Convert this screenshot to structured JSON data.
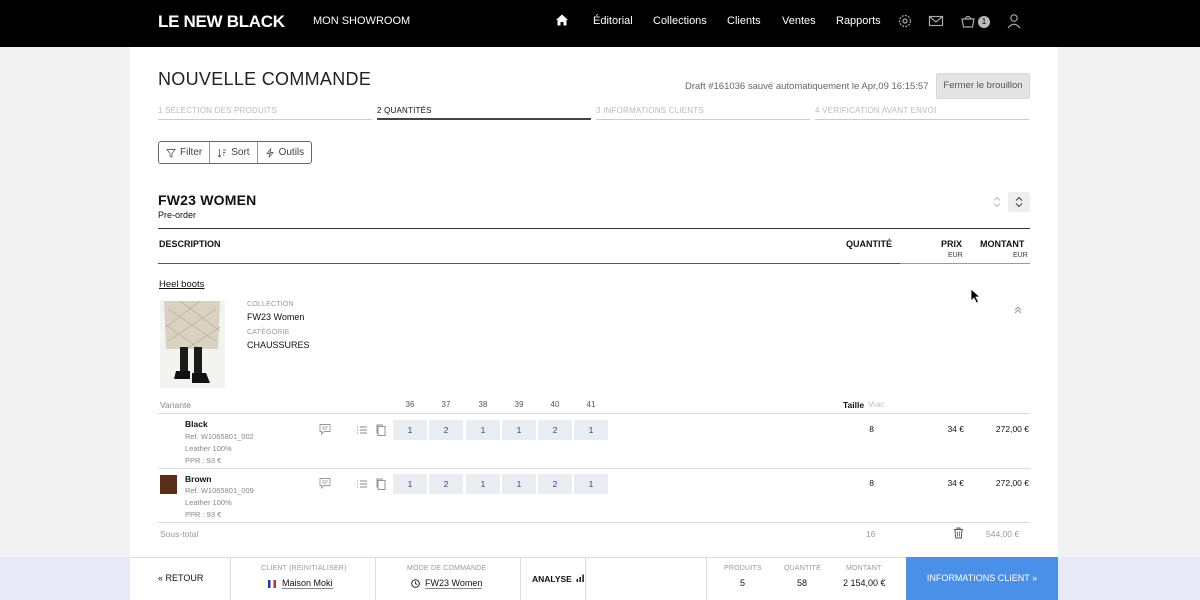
{
  "header": {
    "logo": "LE NEW BLACK",
    "showroom": "MON SHOWROOM",
    "nav": [
      "Éditorial",
      "Collections",
      "Clients",
      "Ventes",
      "Rapports"
    ],
    "cart_count": "1"
  },
  "page": {
    "title": "NOUVELLE COMMANDE",
    "draft_status": "Draft #161036 sauvé automatiquement le Apr,09 16:15:57",
    "close_draft": "Fermer le brouillon"
  },
  "steps": [
    {
      "label": "1 SÉLECTION DES PRODUITS",
      "active": false
    },
    {
      "label": "2 QUANTITÉS",
      "active": true
    },
    {
      "label": "3 INFORMATIONS CLIENTS",
      "active": false
    },
    {
      "label": "4 VÉRIFICATION AVANT ENVOI",
      "active": false
    }
  ],
  "toolbar": {
    "filter": "Filter",
    "sort": "Sort",
    "tools": "Outils"
  },
  "section": {
    "title": "FW23 WOMEN",
    "subtitle": "Pre-order"
  },
  "table_headers": {
    "description": "DESCRIPTION",
    "quantity": "QUANTITÉ",
    "price": "PRIX",
    "price_unit": "EUR",
    "amount": "MONTANT",
    "amount_unit": "EUR"
  },
  "product": {
    "name": "Heel boots",
    "collection_label": "COLLECTION",
    "collection": "FW23 Women",
    "category_label": "CATÉGORIE",
    "category": "CHAUSSURES"
  },
  "grid": {
    "variant_label": "Variante",
    "sizes": [
      "36",
      "37",
      "38",
      "39",
      "40",
      "41"
    ],
    "taille": "Taille",
    "vrac": "Vrac"
  },
  "variants": [
    {
      "name": "Black",
      "ref": "Ref. W1065801_002",
      "material": "Leather 100%",
      "ppr": "PPR : 93 €",
      "swatch": "#ffffff",
      "quantities": [
        "1",
        "2",
        "1",
        "1",
        "2",
        "1"
      ],
      "total_qty": "8",
      "price": "34 €",
      "amount": "272,00 €"
    },
    {
      "name": "Brown",
      "ref": "Ref. W1065801_009",
      "material": "Leather 100%",
      "ppr": "PPR : 93 €",
      "swatch": "#5a2e1a",
      "quantities": [
        "1",
        "2",
        "1",
        "1",
        "2",
        "1"
      ],
      "total_qty": "8",
      "price": "34 €",
      "amount": "272,00 €"
    }
  ],
  "subtotal": {
    "label": "Sous-total",
    "qty": "16",
    "amount": "544,00 €"
  },
  "footer": {
    "back": "« RETOUR",
    "client_label": "CLIENT (RÉINITIALISER)",
    "client": "Maison Moki",
    "mode_label": "MODE DE COMMANDE",
    "mode": "FW23 Women",
    "analyse": "ANALYSE",
    "products_label": "PRODUITS",
    "products": "5",
    "qty_label": "QUANTITÉ",
    "qty": "58",
    "amount_label": "MONTANT",
    "amount": "2 154,00 €",
    "cta": "INFORMATIONS CLIENT »"
  }
}
